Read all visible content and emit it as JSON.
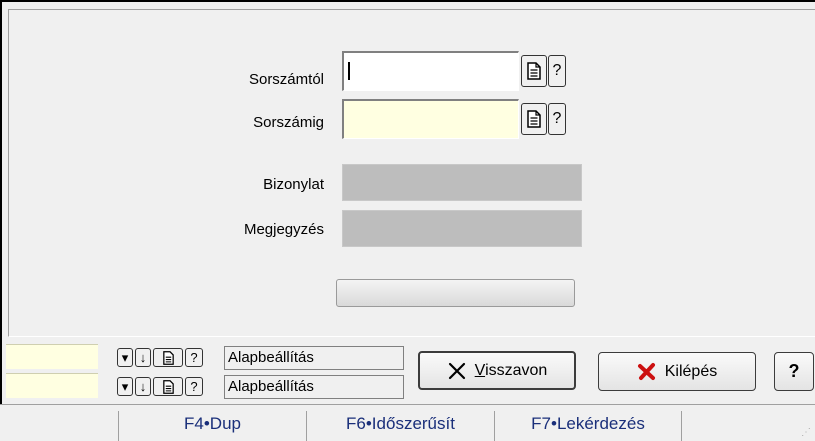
{
  "form": {
    "from_label": "Sorszámtól",
    "to_label": "Sorszámig",
    "document_label": "Bizonylat",
    "note_label": "Megjegyzés",
    "from_value": "",
    "to_value": "",
    "help_glyph": "?",
    "progress": 0
  },
  "filters": [
    {
      "value": "",
      "preset": "Alapbeállítás"
    },
    {
      "value": "",
      "preset": "Alapbeállítás"
    }
  ],
  "buttons": {
    "undo_prefix": "",
    "undo_mnemonic": "V",
    "undo_rest": "isszavon",
    "exit_label": "Kilépés",
    "help_label": "?"
  },
  "statusbar": {
    "items": [
      "F4•Dup",
      "F6•Időszerűsít",
      "F7•Lekérdezés"
    ]
  },
  "colors": {
    "required_field": "#ffffe1",
    "readonly_field": "#bdbdbd",
    "status_text": "#1a2f7a",
    "exit_icon": "#cc1010"
  }
}
